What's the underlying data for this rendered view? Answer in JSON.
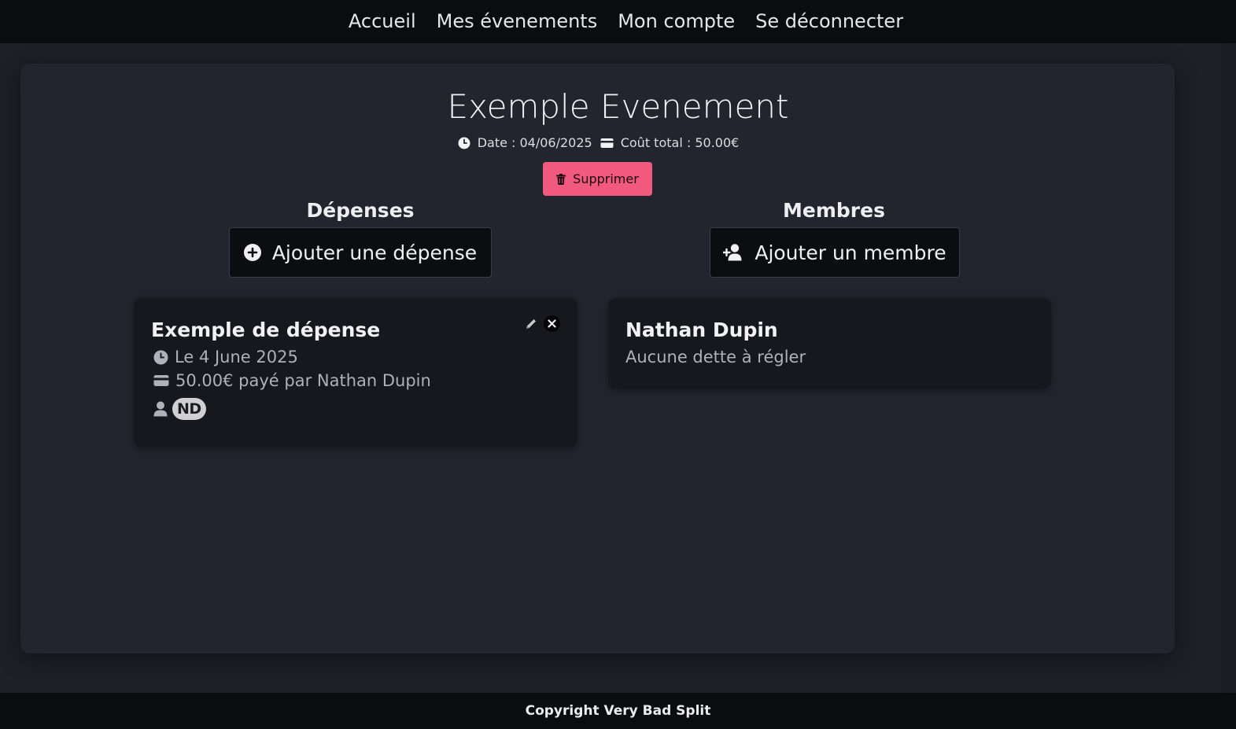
{
  "nav": {
    "items": [
      "Accueil",
      "Mes évenements",
      "Mon compte",
      "Se déconnecter"
    ]
  },
  "event": {
    "title": "Exemple Evenement",
    "date_text": "Date : 04/06/2025",
    "total_text": "Coût total : 50.00€",
    "delete_label": "Supprimer"
  },
  "expenses": {
    "heading": "Dépenses",
    "add_label": "Ajouter une dépense",
    "items": [
      {
        "title": "Exemple de dépense",
        "date": "Le 4 June 2025",
        "amount": "50.00€ payé par Nathan Dupin",
        "participants": [
          "ND"
        ]
      }
    ]
  },
  "members": {
    "heading": "Membres",
    "add_label": "Ajouter un membre",
    "items": [
      {
        "name": "Nathan Dupin",
        "status": "Aucune dette à régler"
      }
    ]
  },
  "footer": {
    "text": "Copyright Very Bad Split"
  },
  "colors": {
    "accent_danger": "#f15a7e",
    "background": "#1d2026",
    "panel": "#22252d",
    "card": "#17181d"
  }
}
